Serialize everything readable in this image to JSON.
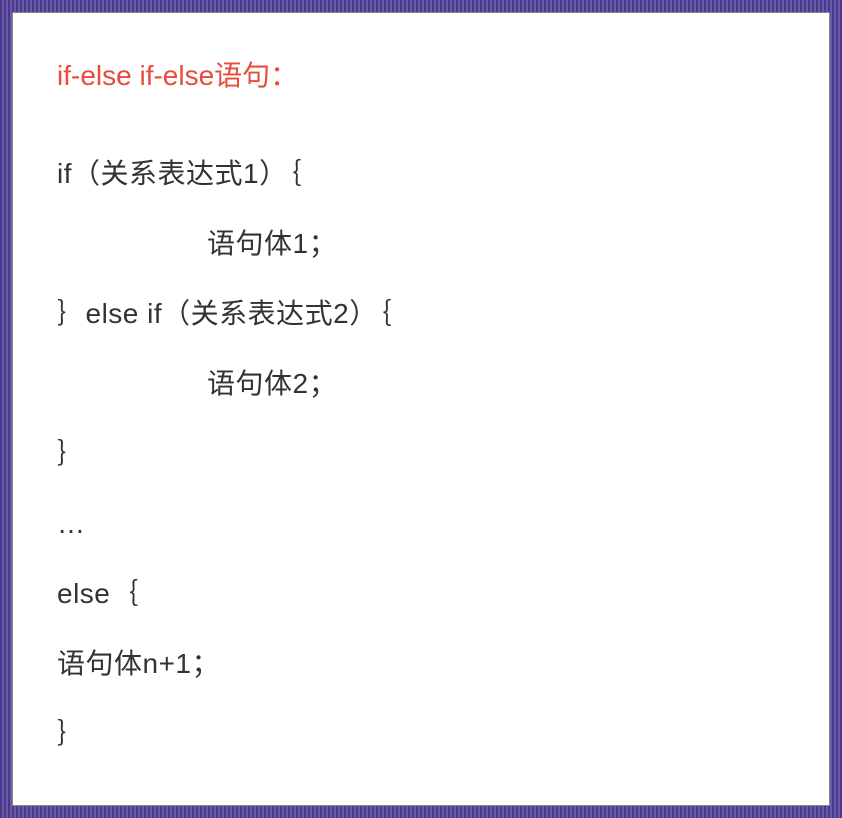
{
  "title": "if-else if-else语句：",
  "lines": [
    "if（关系表达式1）｛",
    "语句体1；",
    "｝else if（关系表达式2）｛",
    "语句体2；",
    "｝",
    "…",
    "else｛",
    "语句体n+1；",
    "｝"
  ]
}
